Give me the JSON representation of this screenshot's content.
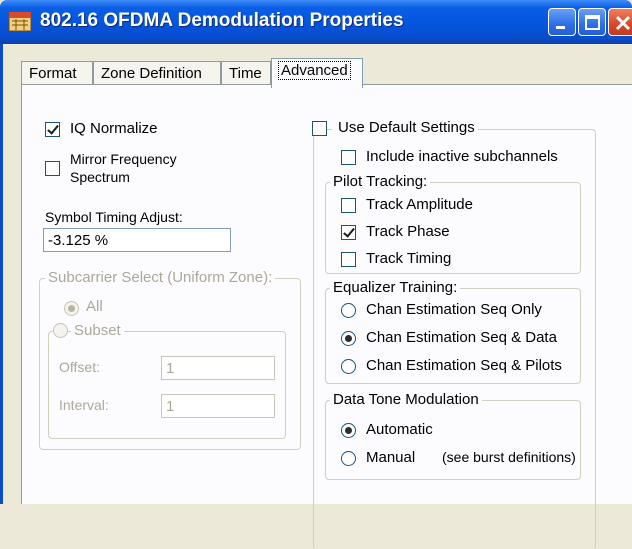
{
  "window": {
    "title": "802.16 OFDMA Demodulation Properties",
    "icon_text": "VSA"
  },
  "tabs": [
    "Format",
    "Zone Definition",
    "Time",
    "Advanced"
  ],
  "active_tab": "Advanced",
  "left": {
    "iq_normalize": {
      "label": "IQ Normalize",
      "checked": true
    },
    "mirror_frequency": {
      "label_line1": "Mirror Frequency",
      "label_line2": "Spectrum",
      "checked": false
    },
    "symbol_timing": {
      "label": "Symbol Timing Adjust:",
      "value": "-3.125 %"
    },
    "subcarrier_group": {
      "legend": "Subcarrier Select (Uniform Zone):",
      "all_label": "All",
      "subset_label": "Subset",
      "offset_label": "Offset:",
      "offset_value": "1",
      "interval_label": "Interval:",
      "interval_value": "1"
    }
  },
  "right": {
    "use_default": {
      "label": "Use Default Settings",
      "checked": false
    },
    "include_inactive": {
      "label": "Include inactive subchannels",
      "checked": false
    },
    "pilot_tracking": {
      "legend": "Pilot Tracking:",
      "amplitude": "Track Amplitude",
      "phase": "Track Phase",
      "timing": "Track Timing"
    },
    "equalizer_training": {
      "legend": "Equalizer Training:",
      "opt1": "Chan Estimation Seq Only",
      "opt2": "Chan Estimation Seq & Data",
      "opt3": "Chan Estimation Seq & Pilots"
    },
    "data_tone": {
      "legend": "Data Tone Modulation",
      "automatic": "Automatic",
      "manual": "Manual",
      "manual_note": "(see burst definitions)"
    }
  },
  "colors": {
    "titlebar": "#0553dc",
    "dialog_bg": "#ece9d8",
    "panel_bg": "#fcfcfe"
  }
}
